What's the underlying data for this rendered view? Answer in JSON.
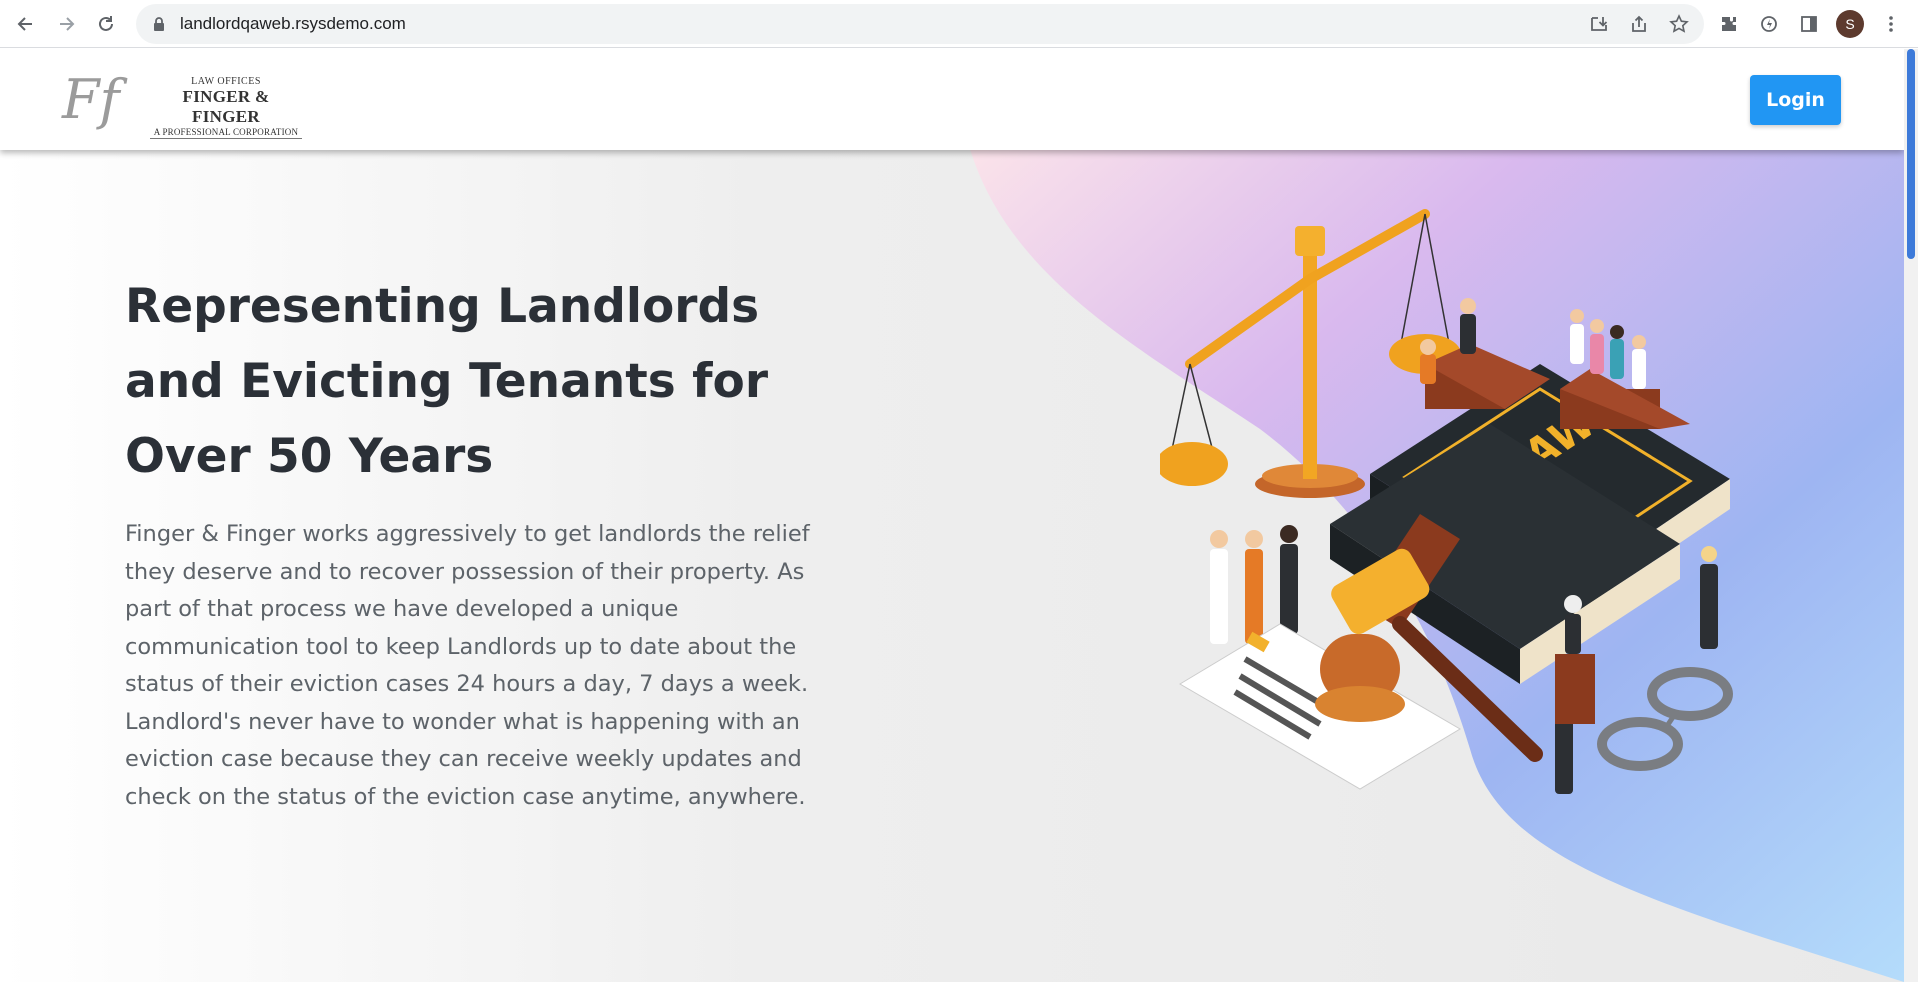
{
  "browser": {
    "url": "landlordqaweb.rsysdemo.com",
    "profile_initial": "S"
  },
  "header": {
    "logo": {
      "line1": "LAW OFFICES",
      "line2": "FINGER & FINGER",
      "line3": "A PROFESSIONAL CORPORATION",
      "monogram": "Ff"
    },
    "login_label": "Login"
  },
  "hero": {
    "title": "Representing Landlords and Evicting Tenants for Over 50 Years",
    "body": "Finger & Finger works aggressively to get landlords the relief they deserve and to recover possession of their property. As part of that process we have developed a unique communication tool to keep Landlords up to date about the status of their eviction cases 24 hours a day, 7 days a week. Landlord's never have to wonder what is happening with an eviction case because they can receive weekly updates and check on the status of the eviction case anytime, anywhere.",
    "illustration_book_label": "LAW"
  },
  "colors": {
    "accent": "#2196f3",
    "title": "#2b3037",
    "body": "#5d6369"
  }
}
